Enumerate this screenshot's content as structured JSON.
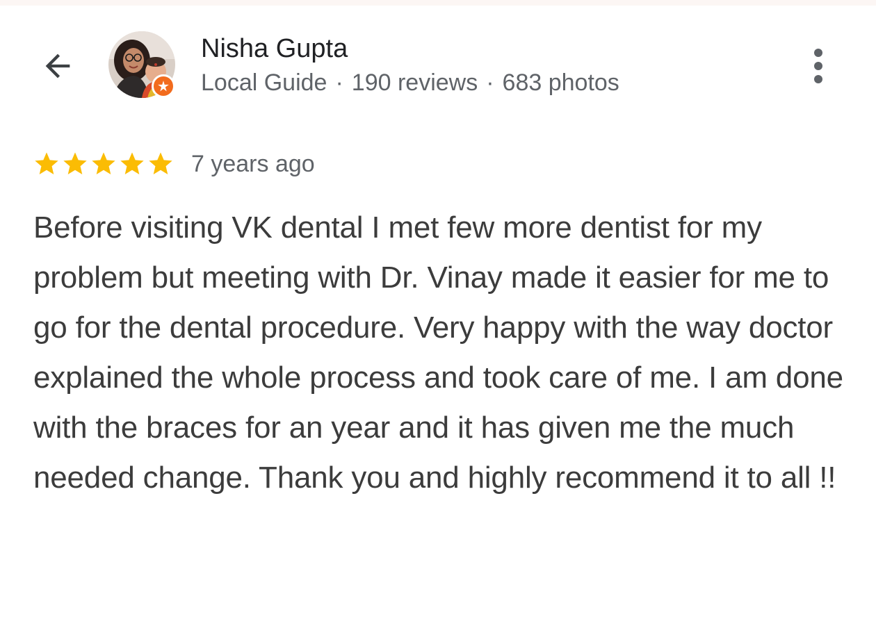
{
  "header": {
    "back_icon": "arrow-back-icon",
    "more_icon": "more-vert-icon",
    "reviewer": {
      "name": "Nisha Gupta",
      "badge": "Local Guide",
      "reviews": "190 reviews",
      "photos": "683 photos",
      "separator": "·",
      "badge_icon": "local-guide-star-icon",
      "badge_color": "#f26b1d"
    }
  },
  "review": {
    "rating": 5,
    "max_rating": 5,
    "star_color": "#fbbc04",
    "time": "7 years ago",
    "text": "Before visiting VK dental I met few more dentist for my problem but meeting with Dr. Vinay made it easier for me to go for the dental procedure. Very happy with the way doctor explained the whole process and took care of me. I am done with the braces for an year and it has given me the much needed change. Thank you and highly recommend it to all !!"
  },
  "colors": {
    "primary_text": "#202124",
    "secondary_text": "#5f6368",
    "body_text": "#3c3c3c",
    "background": "#ffffff"
  }
}
